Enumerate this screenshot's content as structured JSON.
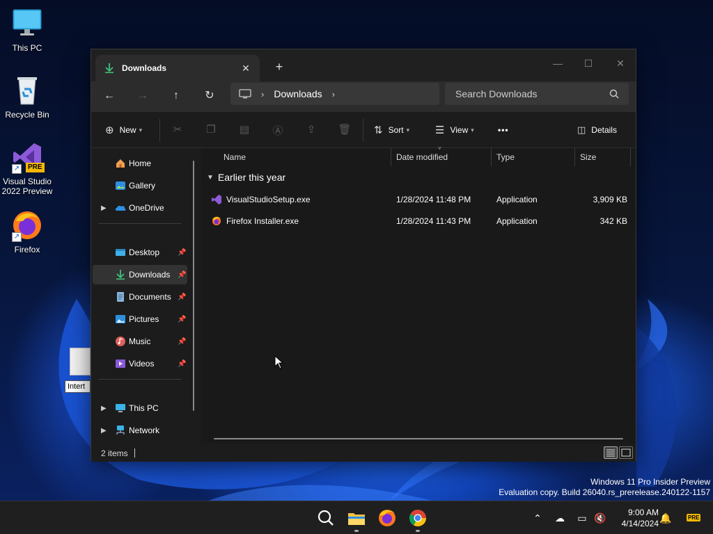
{
  "desktop": {
    "icons": [
      {
        "label": "This PC",
        "icon": "monitor-icon"
      },
      {
        "label": "Recycle Bin",
        "icon": "recycle-bin-icon"
      },
      {
        "label": "Visual Studio 2022 Preview",
        "badge": "PRE",
        "icon": "visual-studio-icon"
      },
      {
        "label": "Firefox",
        "icon": "firefox-icon"
      }
    ],
    "rename_text": "Intert",
    "watermark": {
      "line1": "Windows 11 Pro Insider Preview",
      "line2": "Evaluation copy. Build 26040.rs_prerelease.240122-1157"
    }
  },
  "explorer": {
    "tab": {
      "label": "Downloads",
      "close": "✕"
    },
    "new_tab": "+",
    "window_controls": {
      "minimize": "—",
      "maximize": "☐",
      "close": "✕"
    },
    "nav": {
      "back": "←",
      "forward": "→",
      "up": "↑",
      "refresh": "↻"
    },
    "address": {
      "separator": "›",
      "crumb": "Downloads"
    },
    "search": {
      "placeholder": "Search Downloads"
    },
    "commands": {
      "new": "New",
      "sort": "Sort",
      "view": "View",
      "more": "•••",
      "details": "Details"
    },
    "sidebar": {
      "items": [
        {
          "label": "Home",
          "icon": "home-icon"
        },
        {
          "label": "Gallery",
          "icon": "gallery-icon"
        },
        {
          "label": "OneDrive",
          "icon": "onedrive-icon",
          "expandable": true
        },
        {
          "label": "Desktop",
          "icon": "desktop-folder-icon",
          "pinned": true
        },
        {
          "label": "Downloads",
          "icon": "downloads-icon",
          "pinned": true,
          "selected": true
        },
        {
          "label": "Documents",
          "icon": "documents-icon",
          "pinned": true
        },
        {
          "label": "Pictures",
          "icon": "pictures-icon",
          "pinned": true
        },
        {
          "label": "Music",
          "icon": "music-icon",
          "pinned": true
        },
        {
          "label": "Videos",
          "icon": "videos-icon",
          "pinned": true
        },
        {
          "label": "This PC",
          "icon": "this-pc-icon",
          "expandable": true
        },
        {
          "label": "Network",
          "icon": "network-icon",
          "expandable": true
        }
      ]
    },
    "columns": [
      "Name",
      "Date modified",
      "Type",
      "Size"
    ],
    "group": "Earlier this year",
    "files": [
      {
        "name": "VisualStudioSetup.exe",
        "date": "1/28/2024 11:48 PM",
        "type": "Application",
        "size": "3,909 KB"
      },
      {
        "name": "Firefox Installer.exe",
        "date": "1/28/2024 11:43 PM",
        "type": "Application",
        "size": "342 KB"
      }
    ],
    "status": {
      "count": "2 items"
    }
  },
  "taskbar": {
    "apps": [
      "search-icon",
      "file-explorer-icon",
      "firefox-icon",
      "chrome-icon"
    ],
    "clock": {
      "time": "9:00 AM",
      "date": "4/14/2024"
    },
    "tray_badge": "PRE"
  },
  "colors": {
    "window_bg": "#1c1c1c",
    "accent_download": "#3fc27a",
    "taskbar_bg": "#1f1f1f"
  }
}
